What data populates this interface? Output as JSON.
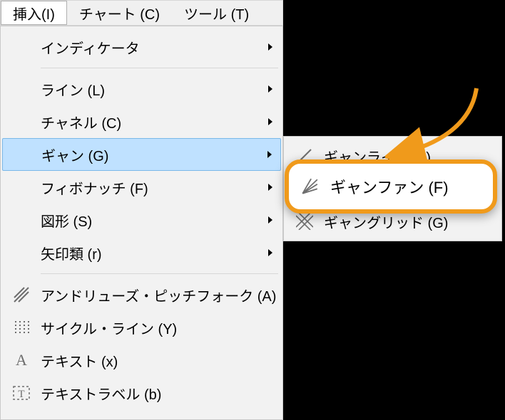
{
  "menubar": {
    "items": [
      {
        "label": "挿入(I)",
        "active": true
      },
      {
        "label": "チャート (C)"
      },
      {
        "label": "ツール (T)"
      }
    ]
  },
  "dropdown": {
    "items": [
      {
        "label": "インディケータ",
        "submenu": true
      },
      {
        "sep": true
      },
      {
        "label": "ライン (L)",
        "submenu": true
      },
      {
        "label": "チャネル (C)",
        "submenu": true
      },
      {
        "label": "ギャン (G)",
        "submenu": true,
        "highlight": true
      },
      {
        "label": "フィボナッチ (F)",
        "submenu": true
      },
      {
        "label": "図形 (S)",
        "submenu": true
      },
      {
        "label": "矢印類 (r)",
        "submenu": true
      },
      {
        "sep": true
      },
      {
        "label": "アンドリューズ・ピッチフォーク (A)",
        "icon": "pitchfork"
      },
      {
        "label": "サイクル・ライン (Y)",
        "icon": "cycle"
      },
      {
        "label": "テキスト (x)",
        "icon": "text"
      },
      {
        "label": "テキストラベル (b)",
        "icon": "textlabel"
      }
    ]
  },
  "submenu": {
    "items": [
      {
        "label": "ギャンライン (L)",
        "icon": "gannline"
      },
      {
        "label": "ギャンファン (F)",
        "icon": "gannfan"
      },
      {
        "label": "ギャングリッド (G)",
        "icon": "ganngrid"
      }
    ]
  },
  "callout": {
    "label": "ギャンファン (F)"
  }
}
